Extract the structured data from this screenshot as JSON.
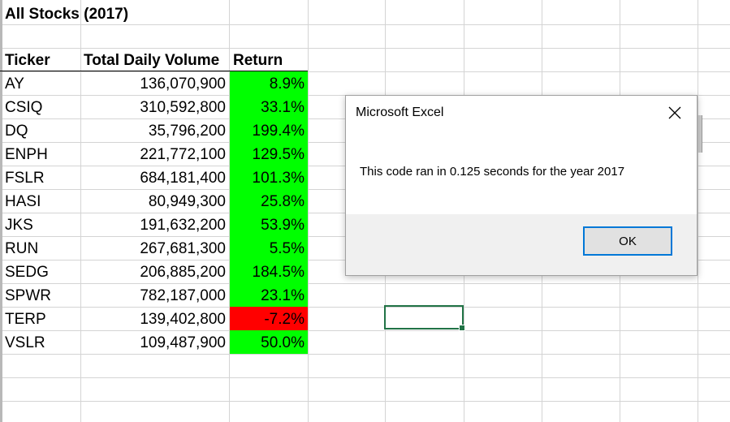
{
  "sheet": {
    "title": "All Stocks (2017)",
    "headers": [
      "Ticker",
      "Total Daily Volume",
      "Return"
    ],
    "rows": [
      {
        "ticker": "AY",
        "volume": "136,070,900",
        "return": "8.9%",
        "status": "positive"
      },
      {
        "ticker": "CSIQ",
        "volume": "310,592,800",
        "return": "33.1%",
        "status": "positive"
      },
      {
        "ticker": "DQ",
        "volume": "35,796,200",
        "return": "199.4%",
        "status": "positive"
      },
      {
        "ticker": "ENPH",
        "volume": "221,772,100",
        "return": "129.5%",
        "status": "positive"
      },
      {
        "ticker": "FSLR",
        "volume": "684,181,400",
        "return": "101.3%",
        "status": "positive"
      },
      {
        "ticker": "HASI",
        "volume": "80,949,300",
        "return": "25.8%",
        "status": "positive"
      },
      {
        "ticker": "JKS",
        "volume": "191,632,200",
        "return": "53.9%",
        "status": "positive"
      },
      {
        "ticker": "RUN",
        "volume": "267,681,300",
        "return": "5.5%",
        "status": "positive"
      },
      {
        "ticker": "SEDG",
        "volume": "206,885,200",
        "return": "184.5%",
        "status": "positive"
      },
      {
        "ticker": "SPWR",
        "volume": "782,187,000",
        "return": "23.1%",
        "status": "positive"
      },
      {
        "ticker": "TERP",
        "volume": "139,402,800",
        "return": "-7.2%",
        "status": "negative"
      },
      {
        "ticker": "VSLR",
        "volume": "109,487,900",
        "return": "50.0%",
        "status": "positive"
      }
    ]
  },
  "colors": {
    "positive_fill": "#00ff00",
    "negative_fill": "#ff0000",
    "selection_border": "#217346",
    "button_focus": "#0078d7"
  },
  "dialog": {
    "title": "Microsoft Excel",
    "message": "This code ran in 0.125 seconds for the year 2017",
    "ok_label": "OK",
    "close_icon": "close-icon"
  }
}
